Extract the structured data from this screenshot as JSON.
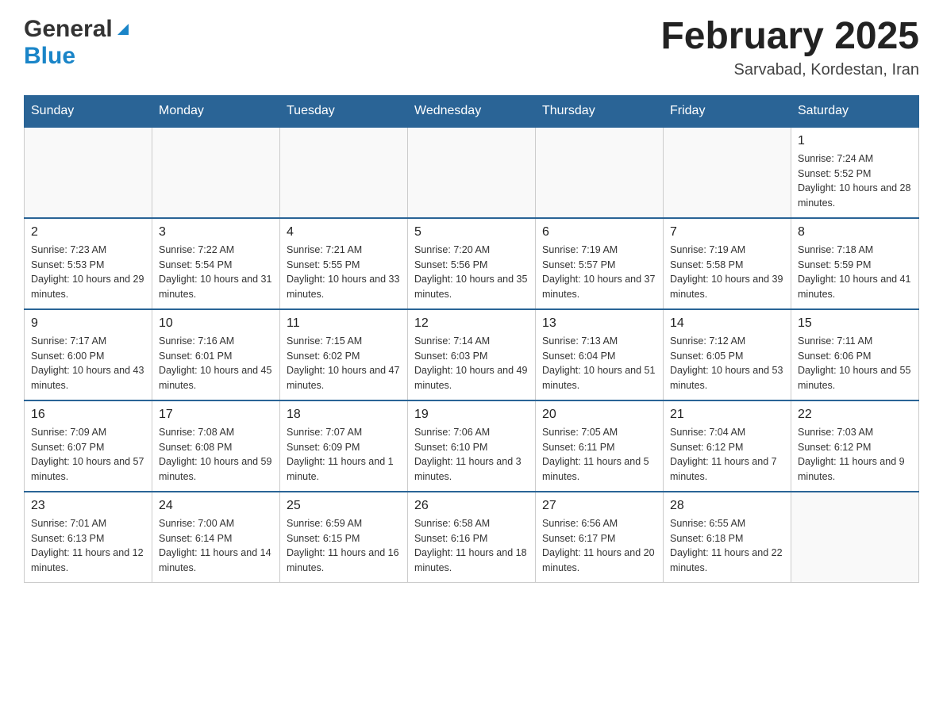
{
  "header": {
    "logo_general": "General",
    "logo_blue": "Blue",
    "month_title": "February 2025",
    "location": "Sarvabad, Kordestan, Iran"
  },
  "weekdays": [
    "Sunday",
    "Monday",
    "Tuesday",
    "Wednesday",
    "Thursday",
    "Friday",
    "Saturday"
  ],
  "weeks": [
    [
      {
        "day": "",
        "info": ""
      },
      {
        "day": "",
        "info": ""
      },
      {
        "day": "",
        "info": ""
      },
      {
        "day": "",
        "info": ""
      },
      {
        "day": "",
        "info": ""
      },
      {
        "day": "",
        "info": ""
      },
      {
        "day": "1",
        "info": "Sunrise: 7:24 AM\nSunset: 5:52 PM\nDaylight: 10 hours and 28 minutes."
      }
    ],
    [
      {
        "day": "2",
        "info": "Sunrise: 7:23 AM\nSunset: 5:53 PM\nDaylight: 10 hours and 29 minutes."
      },
      {
        "day": "3",
        "info": "Sunrise: 7:22 AM\nSunset: 5:54 PM\nDaylight: 10 hours and 31 minutes."
      },
      {
        "day": "4",
        "info": "Sunrise: 7:21 AM\nSunset: 5:55 PM\nDaylight: 10 hours and 33 minutes."
      },
      {
        "day": "5",
        "info": "Sunrise: 7:20 AM\nSunset: 5:56 PM\nDaylight: 10 hours and 35 minutes."
      },
      {
        "day": "6",
        "info": "Sunrise: 7:19 AM\nSunset: 5:57 PM\nDaylight: 10 hours and 37 minutes."
      },
      {
        "day": "7",
        "info": "Sunrise: 7:19 AM\nSunset: 5:58 PM\nDaylight: 10 hours and 39 minutes."
      },
      {
        "day": "8",
        "info": "Sunrise: 7:18 AM\nSunset: 5:59 PM\nDaylight: 10 hours and 41 minutes."
      }
    ],
    [
      {
        "day": "9",
        "info": "Sunrise: 7:17 AM\nSunset: 6:00 PM\nDaylight: 10 hours and 43 minutes."
      },
      {
        "day": "10",
        "info": "Sunrise: 7:16 AM\nSunset: 6:01 PM\nDaylight: 10 hours and 45 minutes."
      },
      {
        "day": "11",
        "info": "Sunrise: 7:15 AM\nSunset: 6:02 PM\nDaylight: 10 hours and 47 minutes."
      },
      {
        "day": "12",
        "info": "Sunrise: 7:14 AM\nSunset: 6:03 PM\nDaylight: 10 hours and 49 minutes."
      },
      {
        "day": "13",
        "info": "Sunrise: 7:13 AM\nSunset: 6:04 PM\nDaylight: 10 hours and 51 minutes."
      },
      {
        "day": "14",
        "info": "Sunrise: 7:12 AM\nSunset: 6:05 PM\nDaylight: 10 hours and 53 minutes."
      },
      {
        "day": "15",
        "info": "Sunrise: 7:11 AM\nSunset: 6:06 PM\nDaylight: 10 hours and 55 minutes."
      }
    ],
    [
      {
        "day": "16",
        "info": "Sunrise: 7:09 AM\nSunset: 6:07 PM\nDaylight: 10 hours and 57 minutes."
      },
      {
        "day": "17",
        "info": "Sunrise: 7:08 AM\nSunset: 6:08 PM\nDaylight: 10 hours and 59 minutes."
      },
      {
        "day": "18",
        "info": "Sunrise: 7:07 AM\nSunset: 6:09 PM\nDaylight: 11 hours and 1 minute."
      },
      {
        "day": "19",
        "info": "Sunrise: 7:06 AM\nSunset: 6:10 PM\nDaylight: 11 hours and 3 minutes."
      },
      {
        "day": "20",
        "info": "Sunrise: 7:05 AM\nSunset: 6:11 PM\nDaylight: 11 hours and 5 minutes."
      },
      {
        "day": "21",
        "info": "Sunrise: 7:04 AM\nSunset: 6:12 PM\nDaylight: 11 hours and 7 minutes."
      },
      {
        "day": "22",
        "info": "Sunrise: 7:03 AM\nSunset: 6:12 PM\nDaylight: 11 hours and 9 minutes."
      }
    ],
    [
      {
        "day": "23",
        "info": "Sunrise: 7:01 AM\nSunset: 6:13 PM\nDaylight: 11 hours and 12 minutes."
      },
      {
        "day": "24",
        "info": "Sunrise: 7:00 AM\nSunset: 6:14 PM\nDaylight: 11 hours and 14 minutes."
      },
      {
        "day": "25",
        "info": "Sunrise: 6:59 AM\nSunset: 6:15 PM\nDaylight: 11 hours and 16 minutes."
      },
      {
        "day": "26",
        "info": "Sunrise: 6:58 AM\nSunset: 6:16 PM\nDaylight: 11 hours and 18 minutes."
      },
      {
        "day": "27",
        "info": "Sunrise: 6:56 AM\nSunset: 6:17 PM\nDaylight: 11 hours and 20 minutes."
      },
      {
        "day": "28",
        "info": "Sunrise: 6:55 AM\nSunset: 6:18 PM\nDaylight: 11 hours and 22 minutes."
      },
      {
        "day": "",
        "info": ""
      }
    ]
  ]
}
